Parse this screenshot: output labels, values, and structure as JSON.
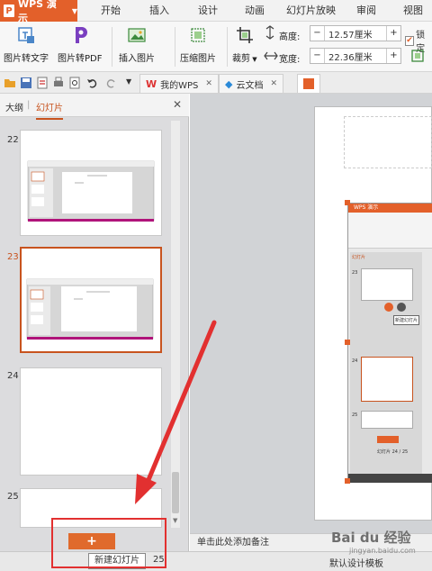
{
  "app": {
    "name": "WPS 演示",
    "logo_letter": "P"
  },
  "menu": [
    "开始",
    "插入",
    "设计",
    "动画",
    "幻灯片放映",
    "审阅",
    "视图"
  ],
  "ribbon": {
    "img_to_text": "图片转文字",
    "img_to_pdf": "图片转PDF",
    "insert_picture": "插入图片",
    "compress": "压缩图片",
    "crop": "裁剪",
    "height_label": "高度:",
    "height_value": "12.57厘米",
    "width_label": "宽度:",
    "width_value": "22.36厘米",
    "lock_label": "锁定"
  },
  "tabs": [
    {
      "label": "我的WPS"
    },
    {
      "label": "云文档"
    }
  ],
  "left_pane": {
    "tab_outline": "大纲",
    "tab_slides": "幻灯片",
    "slides": [
      {
        "num": "22",
        "title": "单击此处添加标题"
      },
      {
        "num": "23",
        "title": "单击此处添加标题"
      },
      {
        "num": "24"
      },
      {
        "num": "25"
      }
    ],
    "add_symbol": "+"
  },
  "notes_placeholder": "单击此处添加备注",
  "status": {
    "tooltip": "新建幻灯片",
    "page_count": "25",
    "template": "默认设计模板"
  },
  "inner_ui": {
    "app_label": "WPS 演示",
    "tab_outline": "大纲",
    "tab_slides": "幻灯片",
    "tooltip": "新建幻灯片",
    "slide_counter": "幻灯片 24 / 25",
    "slide_numbers": [
      "23",
      "24",
      "25"
    ]
  },
  "watermark": {
    "main": "Bai du 经验",
    "sub": "jingyan.baidu.com"
  },
  "colors": {
    "accent": "#e3602a",
    "selected": "#c8531e",
    "annotation": "#e23030"
  }
}
